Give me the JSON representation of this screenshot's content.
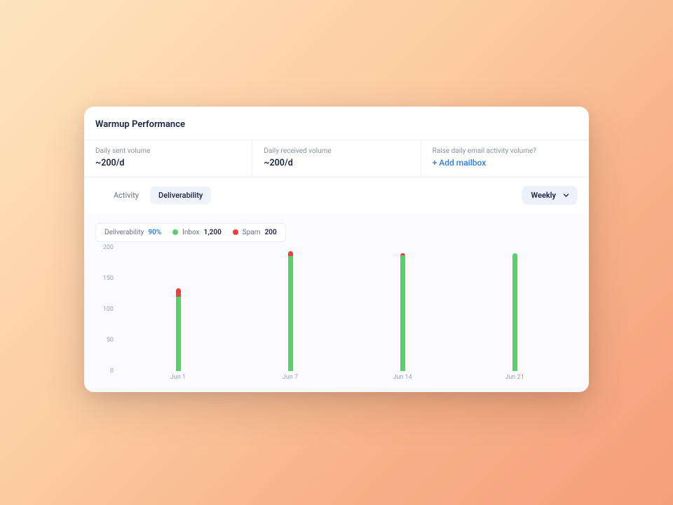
{
  "title": "Warmup Performance",
  "stats": {
    "sent_label": "Daily sent volume",
    "sent_value": "~200/d",
    "received_label": "Daily received volume",
    "received_value": "~200/d",
    "raise_label": "Raise daily email activity volume?",
    "add_mailbox": "+ Add mailbox"
  },
  "tabs": {
    "activity": "Activity",
    "deliverability": "Deliverability"
  },
  "dropdown": {
    "label": "Weekly"
  },
  "legend": {
    "deliverability_label": "Deliverability",
    "deliverability_value": "90%",
    "inbox_label": "Inbox",
    "inbox_value": "1,200",
    "spam_label": "Spam",
    "spam_value": "200"
  },
  "yaxis": [
    "0",
    "50",
    "100",
    "150",
    "200"
  ],
  "chart_data": {
    "type": "bar",
    "categories": [
      "Jun 1",
      "Jun 7",
      "Jun 14",
      "Jun 21"
    ],
    "series": [
      {
        "name": "Inbox",
        "values": [
          120,
          186,
          188,
          190
        ]
      },
      {
        "name": "Spam",
        "values": [
          14,
          8,
          2,
          0
        ]
      }
    ],
    "ylim": [
      0,
      200
    ],
    "ylabel": "",
    "xlabel": "",
    "title": "",
    "colors": {
      "Inbox": "#59cf6c",
      "Spam": "#ef3d3d"
    }
  }
}
